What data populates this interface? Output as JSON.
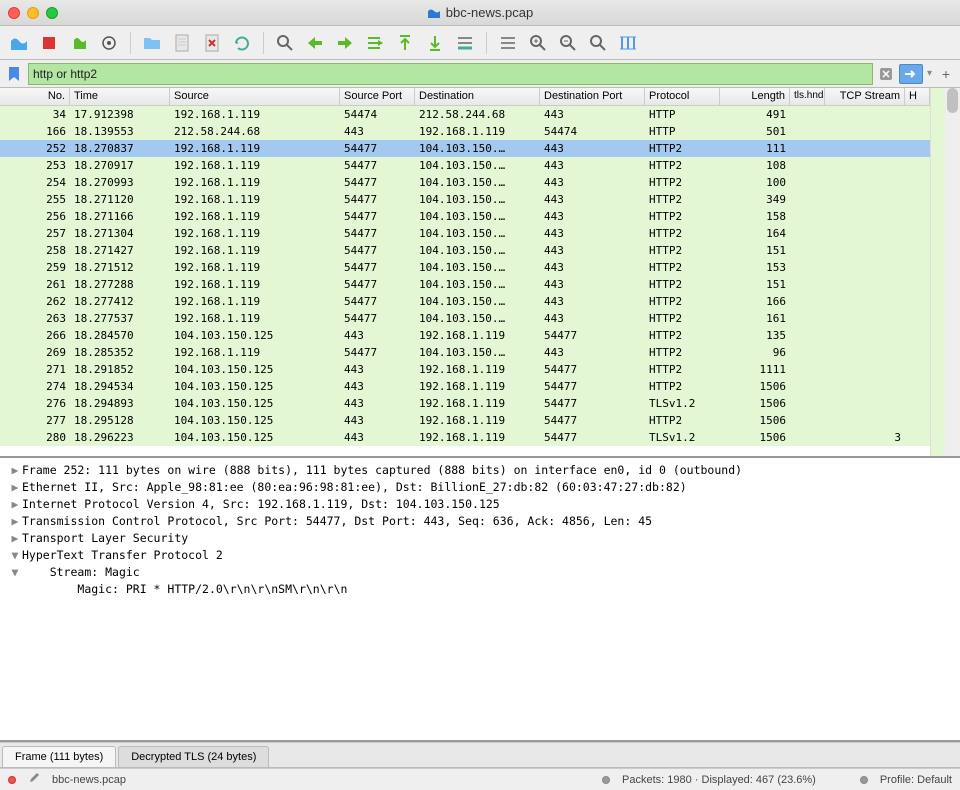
{
  "window": {
    "title": "bbc-news.pcap"
  },
  "filter": {
    "value": "http or http2"
  },
  "columns": {
    "no": "No.",
    "time": "Time",
    "src": "Source",
    "sport": "Source Port",
    "dst": "Destination",
    "dport": "Destination Port",
    "proto": "Protocol",
    "len": "Length",
    "tls": "tls.hndshk.",
    "tcp": "TCP Stream",
    "h": "H"
  },
  "packets": [
    {
      "no": "34",
      "time": "17.912398",
      "src": "192.168.1.119",
      "sport": "54474",
      "dst": "212.58.244.68",
      "dport": "443",
      "proto": "HTTP",
      "len": "491",
      "tls": "",
      "tcp": "",
      "cls": "green"
    },
    {
      "no": "166",
      "time": "18.139553",
      "src": "212.58.244.68",
      "sport": "443",
      "dst": "192.168.1.119",
      "dport": "54474",
      "proto": "HTTP",
      "len": "501",
      "tls": "",
      "tcp": "",
      "cls": "green"
    },
    {
      "no": "252",
      "time": "18.270837",
      "src": "192.168.1.119",
      "sport": "54477",
      "dst": "104.103.150.…",
      "dport": "443",
      "proto": "HTTP2",
      "len": "111",
      "tls": "",
      "tcp": "",
      "cls": "sel"
    },
    {
      "no": "253",
      "time": "18.270917",
      "src": "192.168.1.119",
      "sport": "54477",
      "dst": "104.103.150.…",
      "dport": "443",
      "proto": "HTTP2",
      "len": "108",
      "tls": "",
      "tcp": "",
      "cls": "green"
    },
    {
      "no": "254",
      "time": "18.270993",
      "src": "192.168.1.119",
      "sport": "54477",
      "dst": "104.103.150.…",
      "dport": "443",
      "proto": "HTTP2",
      "len": "100",
      "tls": "",
      "tcp": "",
      "cls": "green"
    },
    {
      "no": "255",
      "time": "18.271120",
      "src": "192.168.1.119",
      "sport": "54477",
      "dst": "104.103.150.…",
      "dport": "443",
      "proto": "HTTP2",
      "len": "349",
      "tls": "",
      "tcp": "",
      "cls": "green"
    },
    {
      "no": "256",
      "time": "18.271166",
      "src": "192.168.1.119",
      "sport": "54477",
      "dst": "104.103.150.…",
      "dport": "443",
      "proto": "HTTP2",
      "len": "158",
      "tls": "",
      "tcp": "",
      "cls": "green"
    },
    {
      "no": "257",
      "time": "18.271304",
      "src": "192.168.1.119",
      "sport": "54477",
      "dst": "104.103.150.…",
      "dport": "443",
      "proto": "HTTP2",
      "len": "164",
      "tls": "",
      "tcp": "",
      "cls": "green"
    },
    {
      "no": "258",
      "time": "18.271427",
      "src": "192.168.1.119",
      "sport": "54477",
      "dst": "104.103.150.…",
      "dport": "443",
      "proto": "HTTP2",
      "len": "151",
      "tls": "",
      "tcp": "",
      "cls": "green"
    },
    {
      "no": "259",
      "time": "18.271512",
      "src": "192.168.1.119",
      "sport": "54477",
      "dst": "104.103.150.…",
      "dport": "443",
      "proto": "HTTP2",
      "len": "153",
      "tls": "",
      "tcp": "",
      "cls": "green"
    },
    {
      "no": "261",
      "time": "18.277288",
      "src": "192.168.1.119",
      "sport": "54477",
      "dst": "104.103.150.…",
      "dport": "443",
      "proto": "HTTP2",
      "len": "151",
      "tls": "",
      "tcp": "",
      "cls": "green"
    },
    {
      "no": "262",
      "time": "18.277412",
      "src": "192.168.1.119",
      "sport": "54477",
      "dst": "104.103.150.…",
      "dport": "443",
      "proto": "HTTP2",
      "len": "166",
      "tls": "",
      "tcp": "",
      "cls": "green"
    },
    {
      "no": "263",
      "time": "18.277537",
      "src": "192.168.1.119",
      "sport": "54477",
      "dst": "104.103.150.…",
      "dport": "443",
      "proto": "HTTP2",
      "len": "161",
      "tls": "",
      "tcp": "",
      "cls": "green"
    },
    {
      "no": "266",
      "time": "18.284570",
      "src": "104.103.150.125",
      "sport": "443",
      "dst": "192.168.1.119",
      "dport": "54477",
      "proto": "HTTP2",
      "len": "135",
      "tls": "",
      "tcp": "",
      "cls": "green"
    },
    {
      "no": "269",
      "time": "18.285352",
      "src": "192.168.1.119",
      "sport": "54477",
      "dst": "104.103.150.…",
      "dport": "443",
      "proto": "HTTP2",
      "len": "96",
      "tls": "",
      "tcp": "",
      "cls": "green"
    },
    {
      "no": "271",
      "time": "18.291852",
      "src": "104.103.150.125",
      "sport": "443",
      "dst": "192.168.1.119",
      "dport": "54477",
      "proto": "HTTP2",
      "len": "1111",
      "tls": "",
      "tcp": "",
      "cls": "green"
    },
    {
      "no": "274",
      "time": "18.294534",
      "src": "104.103.150.125",
      "sport": "443",
      "dst": "192.168.1.119",
      "dport": "54477",
      "proto": "HTTP2",
      "len": "1506",
      "tls": "",
      "tcp": "",
      "cls": "green"
    },
    {
      "no": "276",
      "time": "18.294893",
      "src": "104.103.150.125",
      "sport": "443",
      "dst": "192.168.1.119",
      "dport": "54477",
      "proto": "TLSv1.2",
      "len": "1506",
      "tls": "",
      "tcp": "",
      "cls": "green"
    },
    {
      "no": "277",
      "time": "18.295128",
      "src": "104.103.150.125",
      "sport": "443",
      "dst": "192.168.1.119",
      "dport": "54477",
      "proto": "HTTP2",
      "len": "1506",
      "tls": "",
      "tcp": "",
      "cls": "green"
    },
    {
      "no": "280",
      "time": "18.296223",
      "src": "104.103.150.125",
      "sport": "443",
      "dst": "192.168.1.119",
      "dport": "54477",
      "proto": "TLSv1.2",
      "len": "1506",
      "tls": "",
      "tcp": "3",
      "cls": "green"
    }
  ],
  "details": [
    {
      "ind": 0,
      "open": false,
      "text": "Frame 252: 111 bytes on wire (888 bits), 111 bytes captured (888 bits) on interface en0, id 0 (outbound)"
    },
    {
      "ind": 0,
      "open": false,
      "text": "Ethernet II, Src: Apple_98:81:ee (80:ea:96:98:81:ee), Dst: BillionE_27:db:82 (60:03:47:27:db:82)"
    },
    {
      "ind": 0,
      "open": false,
      "text": "Internet Protocol Version 4, Src: 192.168.1.119, Dst: 104.103.150.125"
    },
    {
      "ind": 0,
      "open": false,
      "text": "Transmission Control Protocol, Src Port: 54477, Dst Port: 443, Seq: 636, Ack: 4856, Len: 45"
    },
    {
      "ind": 0,
      "open": false,
      "text": "Transport Layer Security"
    },
    {
      "ind": 0,
      "open": true,
      "text": "HyperText Transfer Protocol 2"
    },
    {
      "ind": 1,
      "open": true,
      "text": "Stream: Magic"
    },
    {
      "ind": 2,
      "open": null,
      "text": "Magic: PRI * HTTP/2.0\\r\\n\\r\\nSM\\r\\n\\r\\n"
    }
  ],
  "tabs": {
    "frame": "Frame (111 bytes)",
    "tls": "Decrypted TLS (24 bytes)"
  },
  "status": {
    "file": "bbc-news.pcap",
    "packets": "Packets: 1980 · Displayed: 467 (23.6%)",
    "profile": "Profile: Default"
  }
}
